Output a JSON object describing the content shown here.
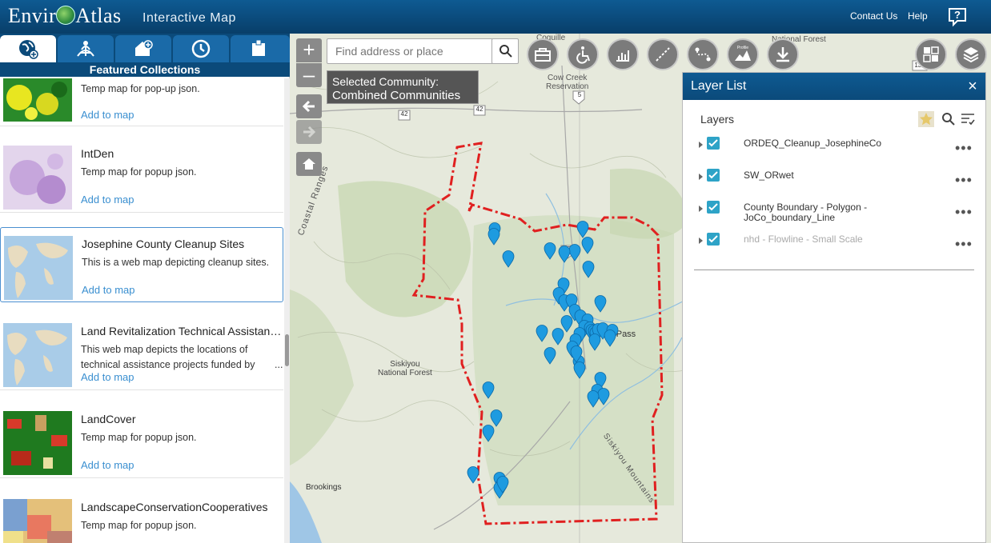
{
  "header": {
    "logo_text": "EnviroAtlas",
    "logo_left": "Envir",
    "logo_right": "Atlas",
    "subtitle": "Interactive Map",
    "contact_label": "Contact Us",
    "help_label": "Help"
  },
  "left_panel": {
    "tabs": [
      {
        "icon": "globe-add-icon",
        "active": true
      },
      {
        "icon": "people-globe-icon",
        "active": false
      },
      {
        "icon": "house-add-icon",
        "active": false
      },
      {
        "icon": "history-clock-icon",
        "active": false
      },
      {
        "icon": "clipboard-icon",
        "active": false
      }
    ],
    "section_title": "Featured Collections",
    "items": [
      {
        "title": "",
        "desc": "Temp map for pop-up json.",
        "add": "Add to map"
      },
      {
        "title": "IntDen",
        "desc": "Temp map for popup json.",
        "add": "Add to map"
      },
      {
        "title": "Josephine County Cleanup Sites",
        "desc": "This is a web map depicting cleanup sites.",
        "add": "Add to map",
        "selected": true
      },
      {
        "title": "Land Revitalization Technical Assistan…",
        "desc": "This web map depicts the locations of technical assistance projects funded by",
        "desc_more": "...",
        "add": "Add to map"
      },
      {
        "title": "LandCover",
        "desc": "Temp map for popup json.",
        "add": "Add to map"
      },
      {
        "title": "LandscapeConservationCooperatives",
        "desc": "Temp map for popup json.",
        "add": ""
      }
    ]
  },
  "map": {
    "search_placeholder": "Find address or place",
    "community_line1": "Selected Community:",
    "community_line2": "Combined Communities",
    "labels": {
      "coquille": "Coquille",
      "cow_creek": "Cow Creek\nReservation",
      "national_forest": "National Forest",
      "coastal_ranges": "Coastal Ranges",
      "siskiyou_nf": "Siskiyou\nNational Forest",
      "siskiyou_mtns": "Siskiyou Mountains",
      "brookings": "Brookings",
      "grants_pass": "nts Pass",
      "hwy_5": "5",
      "hwy_42": "42",
      "hwy_138": "138"
    },
    "zoom_in": "+",
    "zoom_out": "–",
    "tools": [
      "toolbox-icon",
      "accessibility-icon",
      "chart-icon",
      "measure-icon",
      "route-icon",
      "profile-icon",
      "download-icon",
      "basemap-grid-icon",
      "layers-icon"
    ],
    "tool_profile_label": "Profile"
  },
  "layer_list": {
    "title": "Layer List",
    "close": "×",
    "layers_label": "Layers",
    "layers": [
      {
        "name": "ORDEQ_Cleanup_JosephineCo",
        "checked": true,
        "dim": false
      },
      {
        "name": "SW_ORwet",
        "checked": true,
        "dim": false
      },
      {
        "name": "County Boundary - Polygon -",
        "name2": "JoCo_boundary_Line",
        "checked": true,
        "dim": false
      },
      {
        "name": "nhd - Flowline - Small Scale",
        "checked": true,
        "dim": true
      }
    ],
    "more": "•••"
  },
  "colors": {
    "header_bg": "#0b4a7a",
    "accent": "#2ea3c7",
    "link": "#3a8fd0",
    "marker": "#1e9be0",
    "boundary": "#e02020"
  }
}
